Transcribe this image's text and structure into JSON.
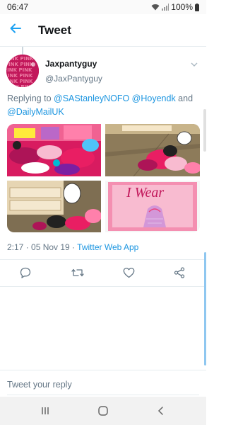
{
  "status_bar": {
    "time": "06:47",
    "battery": "100%"
  },
  "app_bar": {
    "title": "Tweet"
  },
  "tweet": {
    "display_name": "Jaxpantyguy",
    "handle": "@JaxPantyguy",
    "reply_prefix": "Replying to ",
    "mentions": [
      "@SAStanleyNOFO",
      "@Hoyendk",
      "@DailyMailUK"
    ],
    "mention_sep_space": " ",
    "mention_sep_and": " and ",
    "media_text": "I Wear",
    "timestamp": "2:17 · 05 Nov 19 · ",
    "source": "Twitter Web App"
  },
  "reply": {
    "placeholder": "Tweet your reply"
  },
  "colors": {
    "accent": "#1b95e0",
    "back_arrow": "#1da1f2",
    "secondary_text": "#657786"
  },
  "icons": [
    "back-arrow-icon",
    "chevron-down-icon",
    "reply-icon",
    "retweet-icon",
    "like-icon",
    "share-icon",
    "nav-recent-icon",
    "nav-home-icon",
    "nav-back-icon"
  ]
}
